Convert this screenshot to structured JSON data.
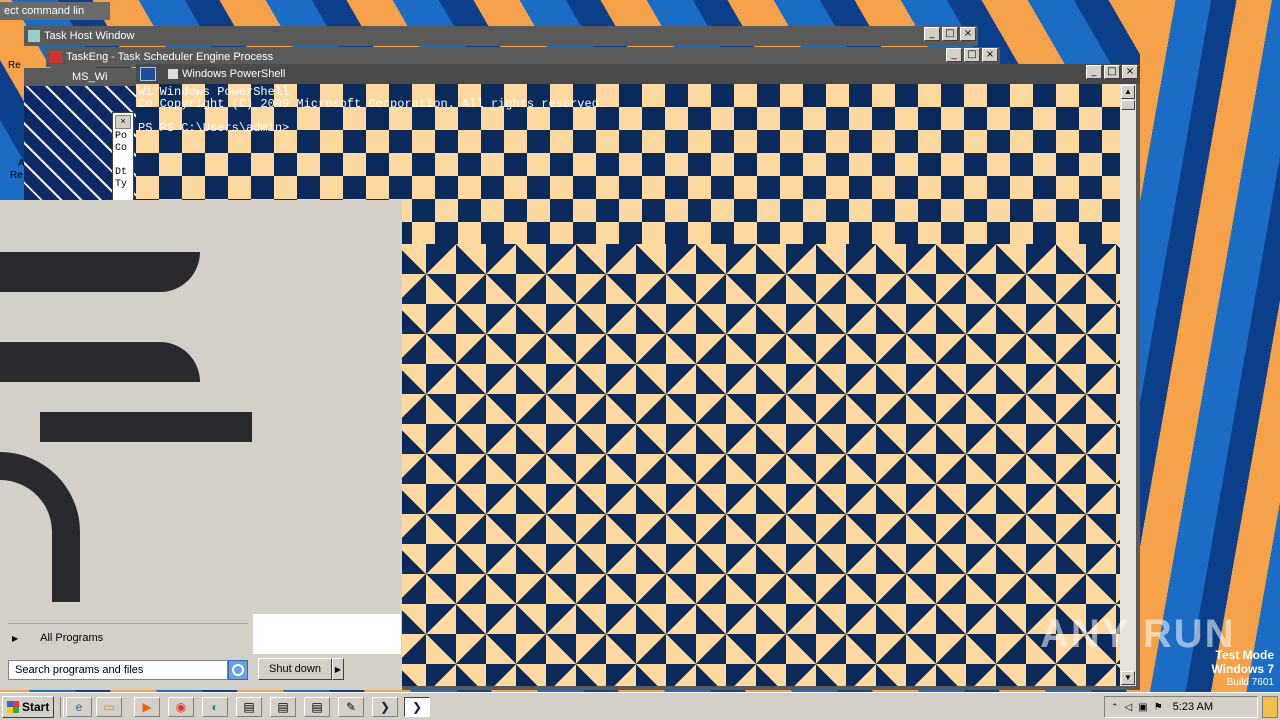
{
  "windows": {
    "cmd_title": "ect command lin",
    "taskhost_title": "Task Host Window",
    "taskeng_title": "TaskEng - Task Scheduler Engine Process",
    "ms_title": "MS_Wi",
    "powershell_title": "Windows PowerShell"
  },
  "powershell": {
    "lines": [
      "Wi Windows PowerShell",
      "Co Copyright (C) 2009 Microsoft Corporation. All rights reserved.",
      "",
      "PS PS C:\\Users\\admin>"
    ]
  },
  "side_window_text": [
    "Po",
    "Co",
    "",
    "Dt",
    "Ty"
  ],
  "desktop_left_labels": [
    "Re",
    "A",
    "Re"
  ],
  "startmenu": {
    "all_programs": "All Programs",
    "search_placeholder": "Search programs and files",
    "shutdown_label": "Shut down"
  },
  "taskbar": {
    "start_label": "Start",
    "items": [
      "ie-icon",
      "explorer-icon",
      "media-player-icon",
      "chrome-icon",
      "edge-icon",
      "window-icon",
      "window-icon",
      "window-icon",
      "notepad-icon",
      "powershell-icon",
      "powershell-active-icon"
    ],
    "clock": "5:23 AM"
  },
  "watermark": {
    "brand": "ANY RUN",
    "mode": "Test Mode",
    "os": "Windows 7",
    "build": "Build 7601"
  },
  "colors": {
    "checker_dark": "#0a2a5c",
    "checker_light": "#ffd9a0",
    "desktop_orange": "#f5a24a",
    "desktop_blue": "#1a6cc4",
    "startmenu_bg": "#d4d0c8"
  }
}
